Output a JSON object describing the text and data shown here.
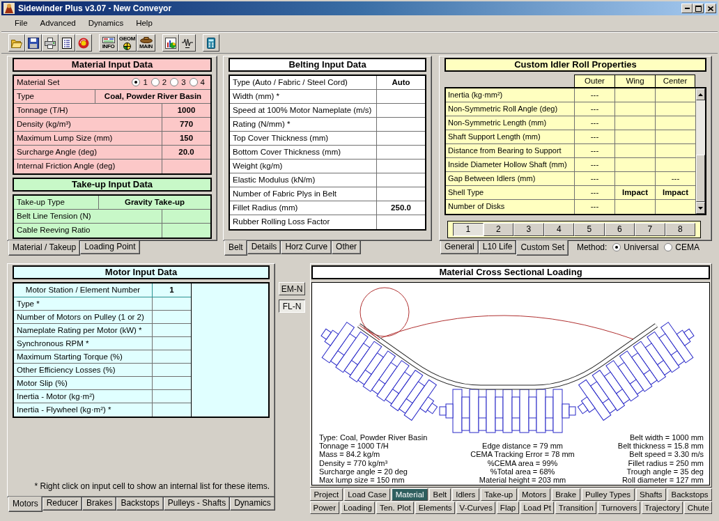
{
  "window": {
    "title": "Sidewinder Plus v3.07 - New Conveyor"
  },
  "menu": [
    {
      "label": "File"
    },
    {
      "label": "Advanced"
    },
    {
      "label": "Dynamics"
    },
    {
      "label": "Help"
    }
  ],
  "toolbar": [
    {
      "buttons": [
        {
          "kind": "open"
        },
        {
          "kind": "save"
        },
        {
          "kind": "print"
        },
        {
          "kind": "report"
        },
        {
          "kind": "reset"
        }
      ]
    },
    {
      "buttons": [
        {
          "kind": "info",
          "label": "INFO"
        },
        {
          "kind": "geom",
          "label": "GEOM"
        },
        {
          "kind": "main",
          "label": "MAIN"
        }
      ]
    },
    {
      "buttons": [
        {
          "kind": "chart"
        },
        {
          "kind": "spring"
        }
      ]
    },
    {
      "buttons": [
        {
          "kind": "calculator"
        }
      ]
    }
  ],
  "material_panel": {
    "material": {
      "title": "Material Input Data",
      "set": {
        "label": "Material Set",
        "options": [
          {
            "label": "1",
            "selected": true
          },
          {
            "label": "2",
            "selected": false
          },
          {
            "label": "3",
            "selected": false
          },
          {
            "label": "4",
            "selected": false
          }
        ]
      },
      "rows": [
        {
          "kind": "wide",
          "label": "Type",
          "value": "Coal, Powder River Basin"
        },
        {
          "kind": "field",
          "label": "Tonnage (T/H)",
          "value": "1000"
        },
        {
          "kind": "field",
          "label": "Density (kg/m³)",
          "value": "770"
        },
        {
          "kind": "field",
          "label": "Maximum Lump Size (mm)",
          "value": "150"
        },
        {
          "kind": "field",
          "label": "Surcharge Angle (deg)",
          "value": "20.0"
        },
        {
          "kind": "field",
          "label": "Internal Friction Angle (deg)"
        }
      ]
    },
    "takeup": {
      "title": "Take-up Input Data",
      "rows": [
        {
          "kind": "wide",
          "label": "Take-up Type",
          "value": "Gravity Take-up"
        },
        {
          "kind": "field",
          "label": "Belt Line Tension (N)"
        },
        {
          "kind": "field",
          "label": "Cable Reeving Ratio"
        }
      ]
    },
    "tabs": [
      {
        "label": "Material / Takeup",
        "selected": true
      },
      {
        "label": "Loading Point",
        "selected": false
      }
    ]
  },
  "belting_panel": {
    "title": "Belting Input Data",
    "rows": [
      {
        "label": "Type (Auto / Fabric / Steel Cord)",
        "value": "Auto"
      },
      {
        "label": "Width (mm) *"
      },
      {
        "label": "Speed at 100% Motor Nameplate (m/s)"
      },
      {
        "label": "Rating (N/mm) *"
      },
      {
        "label": "Top Cover Thickness (mm)"
      },
      {
        "label": "Bottom Cover Thickness (mm)"
      },
      {
        "label": "Weight (kg/m)"
      },
      {
        "label": "Elastic Modulus (kN/m)"
      },
      {
        "label": "Number of Fabric Plys in Belt"
      },
      {
        "label": "Fillet Radius (mm)",
        "value": "250.0"
      },
      {
        "label": "Rubber Rolling Loss Factor"
      }
    ],
    "tabs": [
      {
        "label": "Belt",
        "selected": true
      },
      {
        "label": "Details",
        "selected": false
      },
      {
        "label": "Horz Curve",
        "selected": false
      },
      {
        "label": "Other",
        "selected": false
      }
    ]
  },
  "idler_panel": {
    "title": "Custom Idler Roll Properties",
    "columns": [
      "Outer",
      "Wing",
      "Center"
    ],
    "rows": [
      {
        "label": "Inertia (kg·mm²)",
        "cells": [
          {
            "text": "---",
            "kind": "unused"
          },
          null,
          null
        ]
      },
      {
        "label": "Non-Symmetric Roll Angle (deg)",
        "cells": [
          {
            "text": "---",
            "kind": "unused"
          },
          null,
          null
        ]
      },
      {
        "label": "Non-Symmetric Length (mm)",
        "cells": [
          {
            "text": "---",
            "kind": "unused"
          },
          null,
          null
        ]
      },
      {
        "label": "Shaft Support Length (mm)",
        "cells": [
          {
            "text": "---",
            "kind": "unused"
          },
          null,
          null
        ]
      },
      {
        "label": "Distance from Bearing to Support",
        "cells": [
          {
            "text": "---",
            "kind": "unused"
          },
          null,
          null
        ]
      },
      {
        "label": "Inside Diameter Hollow Shaft (mm)",
        "cells": [
          {
            "text": "---",
            "kind": "unused"
          },
          null,
          null
        ]
      },
      {
        "label": "Gap Between Idlers (mm)",
        "cells": [
          {
            "text": "---",
            "kind": "unused"
          },
          null,
          {
            "text": "---",
            "kind": "unused"
          }
        ]
      },
      {
        "label": "Shell Type",
        "cells": [
          {
            "text": "---",
            "kind": "unused"
          },
          {
            "text": "Impact",
            "kind": "entry"
          },
          {
            "text": "Impact",
            "kind": "entry"
          }
        ]
      },
      {
        "label": "Number of Disks",
        "cells": [
          {
            "text": "---",
            "kind": "unused"
          },
          null,
          null
        ]
      }
    ],
    "sets": [
      {
        "label": "1",
        "selected": true
      },
      {
        "label": "2",
        "selected": false
      },
      {
        "label": "3",
        "selected": false
      },
      {
        "label": "4",
        "selected": false
      },
      {
        "label": "5",
        "selected": false
      },
      {
        "label": "6",
        "selected": false
      },
      {
        "label": "7",
        "selected": false
      },
      {
        "label": "8",
        "selected": false
      }
    ],
    "tabs": [
      {
        "label": "General",
        "selected": false
      },
      {
        "label": "L10 Life",
        "selected": false
      },
      {
        "label": "Custom Set",
        "selected": true
      }
    ],
    "method": {
      "label": "Method:",
      "options": [
        {
          "label": "Universal",
          "selected": true
        },
        {
          "label": "CEMA",
          "selected": false
        }
      ]
    }
  },
  "motor_panel": {
    "title": "Motor Input Data",
    "header": {
      "label": "Motor Station / Element Number",
      "value": "1"
    },
    "rows": [
      {
        "label": "Type *"
      },
      {
        "label": "Number of Motors on Pulley (1 or 2)"
      },
      {
        "label": "Nameplate Rating per Motor (kW) *"
      },
      {
        "label": "Synchronous RPM *"
      },
      {
        "label": "Maximum Starting Torque (%)"
      },
      {
        "label": "Other Efficiency Losses (%)"
      },
      {
        "label": "Motor Slip (%)"
      },
      {
        "label": "Inertia - Motor (kg·m²)"
      },
      {
        "label": "Inertia - Flywheel (kg·m²) *"
      }
    ],
    "note": "* Right click on input cell to show an internal list for these items.",
    "tabs": [
      {
        "label": "Motors",
        "selected": true
      },
      {
        "label": "Reducer",
        "selected": false
      },
      {
        "label": "Brakes",
        "selected": false
      },
      {
        "label": "Backstops",
        "selected": false
      },
      {
        "label": "Pulleys - Shafts",
        "selected": false
      },
      {
        "label": "Dynamics",
        "selected": false
      }
    ]
  },
  "view_buttons": [
    {
      "label": "EM-N",
      "selected": false
    },
    {
      "label": "FL-N",
      "selected": true
    }
  ],
  "cross_section": {
    "title": "Material Cross Sectional Loading",
    "summary_columns": [
      {
        "lines": [
          "Type: Coal, Powder River Basin",
          "Tonnage = 1000 T/H",
          "Mass = 84.2 kg/m",
          "Density = 770 kg/m³",
          "Surcharge angle = 20 deg",
          "Max lump size = 150 mm"
        ]
      },
      {
        "lines": [
          "Edge distance = 79 mm",
          "CEMA Tracking Error = 78 mm",
          "%CEMA area = 99%",
          "%Total area = 68%",
          "Material height = 203 mm"
        ]
      },
      {
        "lines": [
          "Belt width = 1000 mm",
          "Belt thickness = 15.8 mm",
          "Belt speed = 3.30 m/s",
          "Fillet radius = 250 mm",
          "Trough angle = 35 deg",
          "Roll diameter = 127 mm"
        ]
      }
    ]
  },
  "section_tabs": [
    {
      "tabs": [
        {
          "label": "Project",
          "selected": false
        },
        {
          "label": "Load Case",
          "selected": false
        },
        {
          "label": "Material",
          "selected": true
        },
        {
          "label": "Belt",
          "selected": false
        },
        {
          "label": "Idlers",
          "selected": false
        },
        {
          "label": "Take-up",
          "selected": false
        },
        {
          "label": "Motors",
          "selected": false
        },
        {
          "label": "Brake",
          "selected": false
        },
        {
          "label": "Pulley Types",
          "selected": false
        },
        {
          "label": "Shafts",
          "selected": false
        },
        {
          "label": "Backstops",
          "selected": false
        }
      ]
    },
    {
      "tabs": [
        {
          "label": "Power",
          "selected": false
        },
        {
          "label": "Loading",
          "selected": false
        },
        {
          "label": "Ten. Plot",
          "selected": false
        },
        {
          "label": "Elements",
          "selected": false
        },
        {
          "label": "V-Curves",
          "selected": false
        },
        {
          "label": "Flap",
          "selected": false
        },
        {
          "label": "Load Pt",
          "selected": false
        },
        {
          "label": "Transition",
          "selected": false
        },
        {
          "label": "Turnovers",
          "selected": false
        },
        {
          "label": "Trajectory",
          "selected": false
        },
        {
          "label": "Chute",
          "selected": false
        }
      ]
    }
  ]
}
